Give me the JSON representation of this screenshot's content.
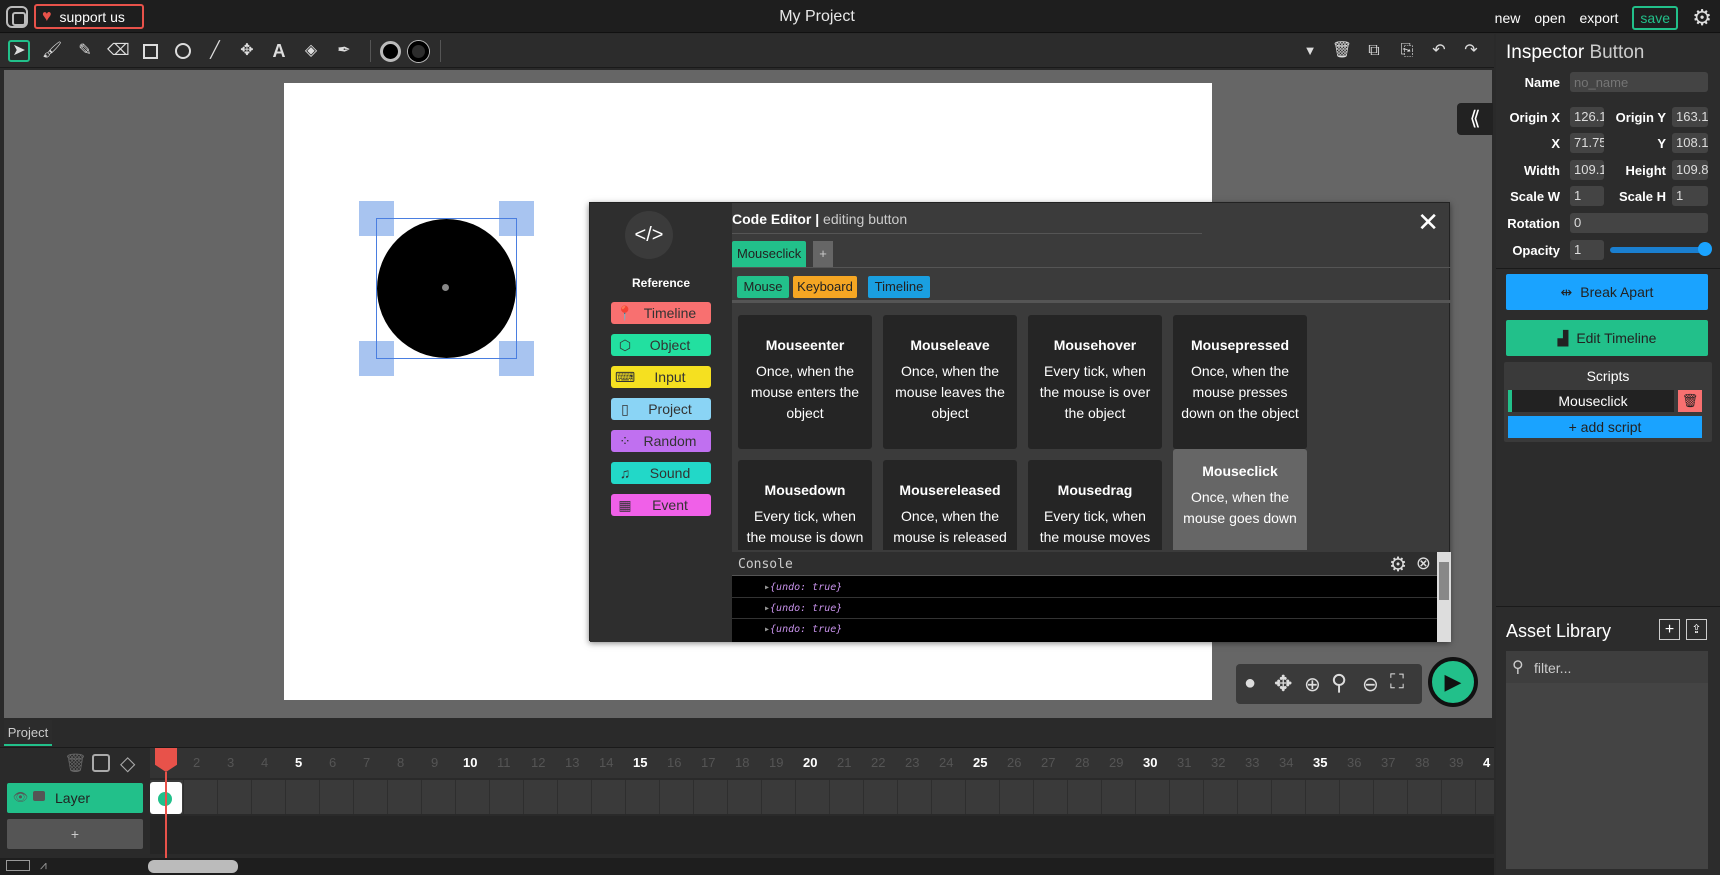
{
  "topbar": {
    "support_label": "support us",
    "project_title": "My Project",
    "menu": [
      "new",
      "open",
      "export"
    ],
    "save_label": "save"
  },
  "toolbar": {
    "tools": [
      "cursor-icon",
      "brush-icon",
      "pencil-icon",
      "eraser-icon",
      "rectangle-icon",
      "ellipse-icon",
      "line-icon",
      "pathcursor-icon",
      "text-icon",
      "fill-bucket-icon",
      "eyedropper-icon"
    ]
  },
  "inspector": {
    "title": "Inspector",
    "type": "Button",
    "name_label": "Name",
    "name_placeholder": "no_name",
    "origin_x_label": "Origin X",
    "origin_x": "126.1",
    "origin_y_label": "Origin Y",
    "origin_y": "163.1",
    "x_label": "X",
    "x": "71.75",
    "y_label": "Y",
    "y": "108.1",
    "width_label": "Width",
    "width": "109.1",
    "height_label": "Height",
    "height": "109.8",
    "scale_w_label": "Scale W",
    "scale_w": "1",
    "scale_h_label": "Scale H",
    "scale_h": "1",
    "rotation_label": "Rotation",
    "rotation": "0",
    "opacity_label": "Opacity",
    "opacity": "1",
    "break_apart_label": "Break Apart",
    "edit_timeline_label": "Edit Timeline",
    "scripts_title": "Scripts",
    "scripts": [
      "Mouseclick"
    ],
    "add_script_label": "+ add script"
  },
  "asset_library": {
    "title": "Asset Library",
    "filter_placeholder": "filter..."
  },
  "code_editor": {
    "title": "Code Editor",
    "subtitle": "editing button",
    "reference_label": "Reference",
    "reference_items": [
      "Timeline",
      "Object",
      "Input",
      "Project",
      "Random",
      "Sound",
      "Event"
    ],
    "active_tab": "Mouseclick",
    "add_tab": "+",
    "categories": [
      "Mouse",
      "Keyboard",
      "Timeline"
    ],
    "events": [
      {
        "title": "Mouseenter",
        "desc": "Once, when the mouse enters the object"
      },
      {
        "title": "Mouseleave",
        "desc": "Once, when the mouse leaves the object"
      },
      {
        "title": "Mousehover",
        "desc": "Every tick, when the mouse is over the object"
      },
      {
        "title": "Mousepressed",
        "desc": "Once, when the mouse presses down on the object"
      },
      {
        "title": "Mousedown",
        "desc": "Every tick, when the mouse is down"
      },
      {
        "title": "Mousereleased",
        "desc": "Once, when the mouse is released"
      },
      {
        "title": "Mousedrag",
        "desc": "Every tick, when the mouse moves"
      },
      {
        "title": "Mouseclick",
        "desc": "Once, when the mouse goes down"
      }
    ],
    "console_label": "Console",
    "console_lines": [
      "{undo: true}",
      "{undo: true}",
      "{undo: true}"
    ]
  },
  "timeline": {
    "tab_label": "Project",
    "layer_name": "Layer",
    "add_layer": "+",
    "frame_numbers": [
      "5",
      "10",
      "15",
      "20",
      "25",
      "30",
      "35",
      "4"
    ],
    "minor_frames": [
      "2",
      "3",
      "4",
      "6",
      "7",
      "8",
      "9",
      "11",
      "12",
      "13",
      "14",
      "16",
      "17",
      "18",
      "19",
      "21",
      "22",
      "23",
      "24",
      "26",
      "27",
      "28",
      "29",
      "31",
      "32",
      "33",
      "34",
      "36",
      "37",
      "38",
      "39"
    ]
  },
  "colors": {
    "accent_green": "#22c08a",
    "accent_blue": "#1aa3ff",
    "ref_timeline": "#f87070",
    "ref_object": "#22e0a0",
    "ref_input": "#f5e020",
    "ref_project": "#8ad4f5",
    "ref_random": "#c070f0",
    "ref_sound": "#22d8c8",
    "ref_event": "#f060e8"
  }
}
